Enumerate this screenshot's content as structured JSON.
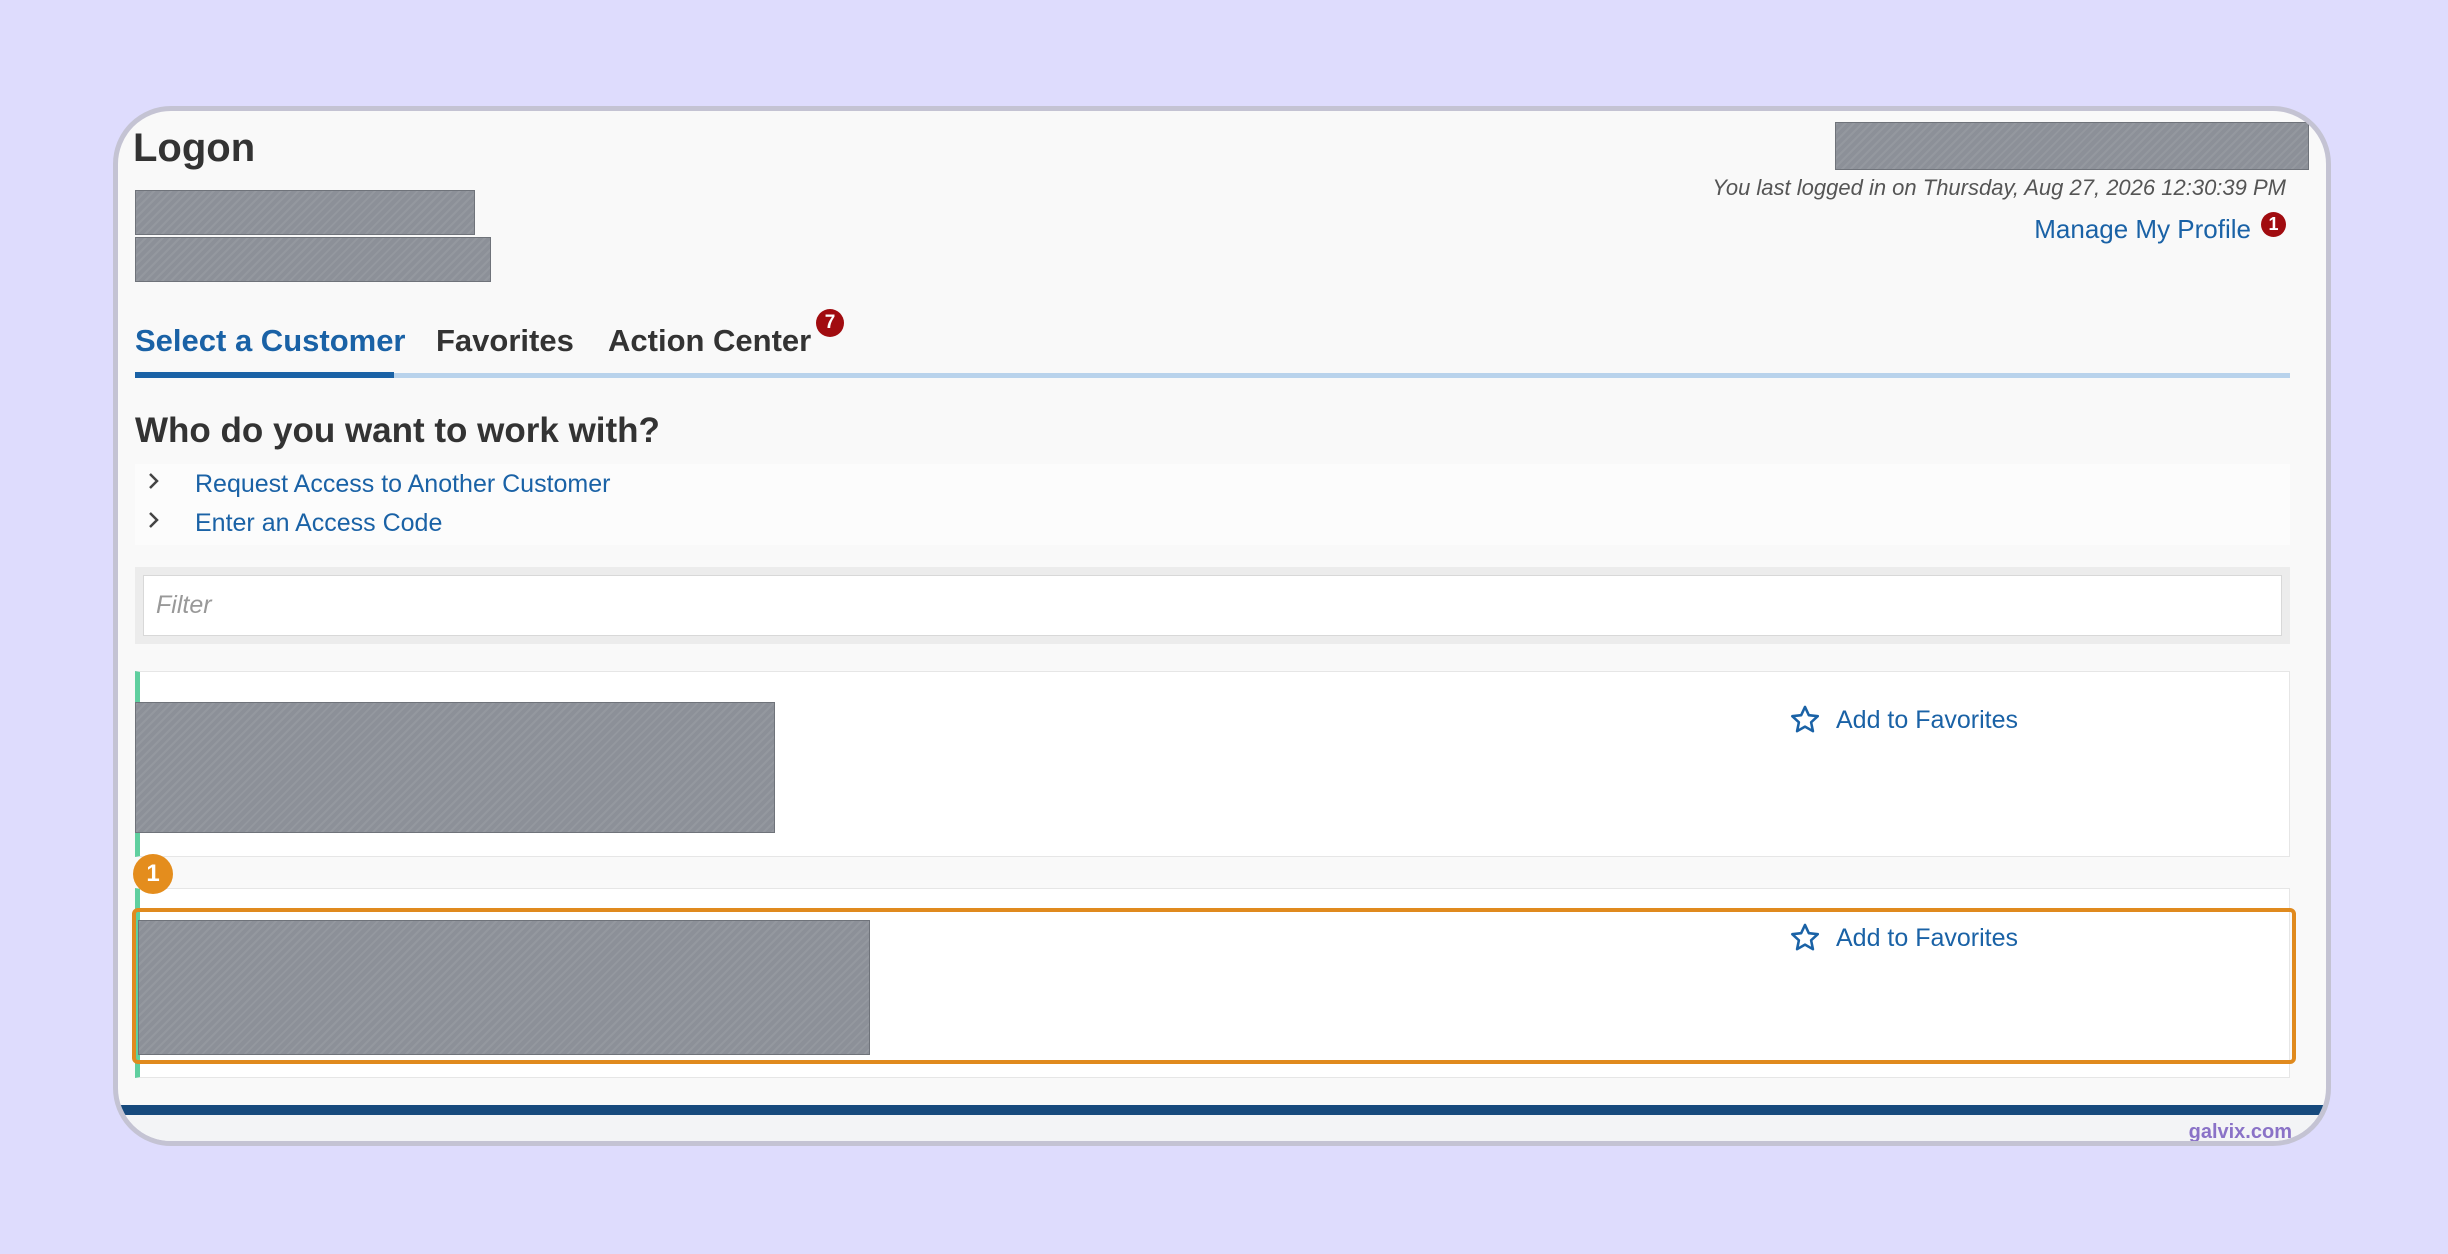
{
  "header": {
    "title": "Logon",
    "last_login": "You last logged in on Thursday, Aug 27, 2026 12:30:39 PM",
    "manage_profile_label": "Manage My Profile",
    "manage_profile_badge": "1"
  },
  "tabs": [
    {
      "label": "Select a Customer",
      "active": true
    },
    {
      "label": "Favorites",
      "active": false
    },
    {
      "label": "Action Center",
      "active": false,
      "badge": "7"
    }
  ],
  "main": {
    "heading": "Who do you want to work with?",
    "expanders": [
      {
        "label": "Request Access to Another Customer"
      },
      {
        "label": "Enter an Access Code"
      }
    ],
    "filter_placeholder": "Filter",
    "customers": [
      {
        "favorite_label": "Add to Favorites"
      },
      {
        "favorite_label": "Add to Favorites"
      }
    ]
  },
  "tutorial": {
    "step_number": "1"
  },
  "watermark": "galvix.com",
  "colors": {
    "link": "#1a62a6",
    "badge": "#a10c10",
    "highlight": "#e08a1e",
    "card_accent": "#5fcf9f",
    "footer": "#174a7d"
  },
  "icons": {
    "expander": "chevron-right-icon",
    "favorite": "star-outline-icon"
  }
}
